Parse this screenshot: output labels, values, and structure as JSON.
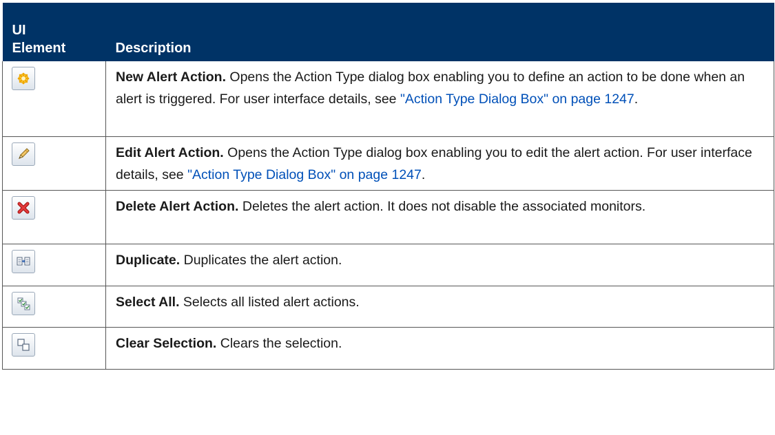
{
  "table": {
    "header": {
      "col1": "UI\nElement",
      "col1_line1": "UI",
      "col1_line2": "Element",
      "col2": "Description"
    },
    "rows": [
      {
        "icon": "new-alert-action-icon",
        "term": "New Alert Action.",
        "text": " Opens the Action Type dialog box enabling you to define an action to be done when an alert is triggered. For user interface details, see ",
        "link": "\"Action Type Dialog Box\" on page 1247",
        "tail": "."
      },
      {
        "icon": "edit-alert-action-icon",
        "term": "Edit Alert Action.",
        "text": " Opens the Action Type dialog box enabling you to edit the alert action. For user interface details, see ",
        "link": "\"Action Type Dialog Box\" on page 1247",
        "tail": "."
      },
      {
        "icon": "delete-alert-action-icon",
        "term": "Delete Alert Action.",
        "text": " Deletes the alert action. It does not disable the associated monitors."
      },
      {
        "icon": "duplicate-icon",
        "term": "Duplicate.",
        "text": " Duplicates the alert action."
      },
      {
        "icon": "select-all-icon",
        "term": "Select All.",
        "text": " Selects all listed alert actions."
      },
      {
        "icon": "clear-selection-icon",
        "term": "Clear Selection.",
        "text": " Clears the selection."
      }
    ]
  },
  "colors": {
    "header_bg": "#003366",
    "header_text": "#ffffff",
    "link": "#0050b8",
    "new_icon": "#f0a800",
    "delete_icon": "#d42020"
  }
}
